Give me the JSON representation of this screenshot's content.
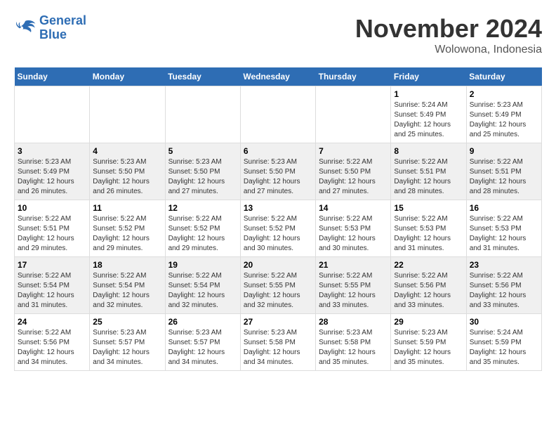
{
  "logo": {
    "line1": "General",
    "line2": "Blue"
  },
  "title": "November 2024",
  "location": "Wolowona, Indonesia",
  "weekdays": [
    "Sunday",
    "Monday",
    "Tuesday",
    "Wednesday",
    "Thursday",
    "Friday",
    "Saturday"
  ],
  "weeks": [
    [
      {
        "day": "",
        "info": ""
      },
      {
        "day": "",
        "info": ""
      },
      {
        "day": "",
        "info": ""
      },
      {
        "day": "",
        "info": ""
      },
      {
        "day": "",
        "info": ""
      },
      {
        "day": "1",
        "info": "Sunrise: 5:24 AM\nSunset: 5:49 PM\nDaylight: 12 hours\nand 25 minutes."
      },
      {
        "day": "2",
        "info": "Sunrise: 5:23 AM\nSunset: 5:49 PM\nDaylight: 12 hours\nand 25 minutes."
      }
    ],
    [
      {
        "day": "3",
        "info": "Sunrise: 5:23 AM\nSunset: 5:49 PM\nDaylight: 12 hours\nand 26 minutes."
      },
      {
        "day": "4",
        "info": "Sunrise: 5:23 AM\nSunset: 5:50 PM\nDaylight: 12 hours\nand 26 minutes."
      },
      {
        "day": "5",
        "info": "Sunrise: 5:23 AM\nSunset: 5:50 PM\nDaylight: 12 hours\nand 27 minutes."
      },
      {
        "day": "6",
        "info": "Sunrise: 5:23 AM\nSunset: 5:50 PM\nDaylight: 12 hours\nand 27 minutes."
      },
      {
        "day": "7",
        "info": "Sunrise: 5:22 AM\nSunset: 5:50 PM\nDaylight: 12 hours\nand 27 minutes."
      },
      {
        "day": "8",
        "info": "Sunrise: 5:22 AM\nSunset: 5:51 PM\nDaylight: 12 hours\nand 28 minutes."
      },
      {
        "day": "9",
        "info": "Sunrise: 5:22 AM\nSunset: 5:51 PM\nDaylight: 12 hours\nand 28 minutes."
      }
    ],
    [
      {
        "day": "10",
        "info": "Sunrise: 5:22 AM\nSunset: 5:51 PM\nDaylight: 12 hours\nand 29 minutes."
      },
      {
        "day": "11",
        "info": "Sunrise: 5:22 AM\nSunset: 5:52 PM\nDaylight: 12 hours\nand 29 minutes."
      },
      {
        "day": "12",
        "info": "Sunrise: 5:22 AM\nSunset: 5:52 PM\nDaylight: 12 hours\nand 29 minutes."
      },
      {
        "day": "13",
        "info": "Sunrise: 5:22 AM\nSunset: 5:52 PM\nDaylight: 12 hours\nand 30 minutes."
      },
      {
        "day": "14",
        "info": "Sunrise: 5:22 AM\nSunset: 5:53 PM\nDaylight: 12 hours\nand 30 minutes."
      },
      {
        "day": "15",
        "info": "Sunrise: 5:22 AM\nSunset: 5:53 PM\nDaylight: 12 hours\nand 31 minutes."
      },
      {
        "day": "16",
        "info": "Sunrise: 5:22 AM\nSunset: 5:53 PM\nDaylight: 12 hours\nand 31 minutes."
      }
    ],
    [
      {
        "day": "17",
        "info": "Sunrise: 5:22 AM\nSunset: 5:54 PM\nDaylight: 12 hours\nand 31 minutes."
      },
      {
        "day": "18",
        "info": "Sunrise: 5:22 AM\nSunset: 5:54 PM\nDaylight: 12 hours\nand 32 minutes."
      },
      {
        "day": "19",
        "info": "Sunrise: 5:22 AM\nSunset: 5:54 PM\nDaylight: 12 hours\nand 32 minutes."
      },
      {
        "day": "20",
        "info": "Sunrise: 5:22 AM\nSunset: 5:55 PM\nDaylight: 12 hours\nand 32 minutes."
      },
      {
        "day": "21",
        "info": "Sunrise: 5:22 AM\nSunset: 5:55 PM\nDaylight: 12 hours\nand 33 minutes."
      },
      {
        "day": "22",
        "info": "Sunrise: 5:22 AM\nSunset: 5:56 PM\nDaylight: 12 hours\nand 33 minutes."
      },
      {
        "day": "23",
        "info": "Sunrise: 5:22 AM\nSunset: 5:56 PM\nDaylight: 12 hours\nand 33 minutes."
      }
    ],
    [
      {
        "day": "24",
        "info": "Sunrise: 5:22 AM\nSunset: 5:56 PM\nDaylight: 12 hours\nand 34 minutes."
      },
      {
        "day": "25",
        "info": "Sunrise: 5:23 AM\nSunset: 5:57 PM\nDaylight: 12 hours\nand 34 minutes."
      },
      {
        "day": "26",
        "info": "Sunrise: 5:23 AM\nSunset: 5:57 PM\nDaylight: 12 hours\nand 34 minutes."
      },
      {
        "day": "27",
        "info": "Sunrise: 5:23 AM\nSunset: 5:58 PM\nDaylight: 12 hours\nand 34 minutes."
      },
      {
        "day": "28",
        "info": "Sunrise: 5:23 AM\nSunset: 5:58 PM\nDaylight: 12 hours\nand 35 minutes."
      },
      {
        "day": "29",
        "info": "Sunrise: 5:23 AM\nSunset: 5:59 PM\nDaylight: 12 hours\nand 35 minutes."
      },
      {
        "day": "30",
        "info": "Sunrise: 5:24 AM\nSunset: 5:59 PM\nDaylight: 12 hours\nand 35 minutes."
      }
    ]
  ]
}
